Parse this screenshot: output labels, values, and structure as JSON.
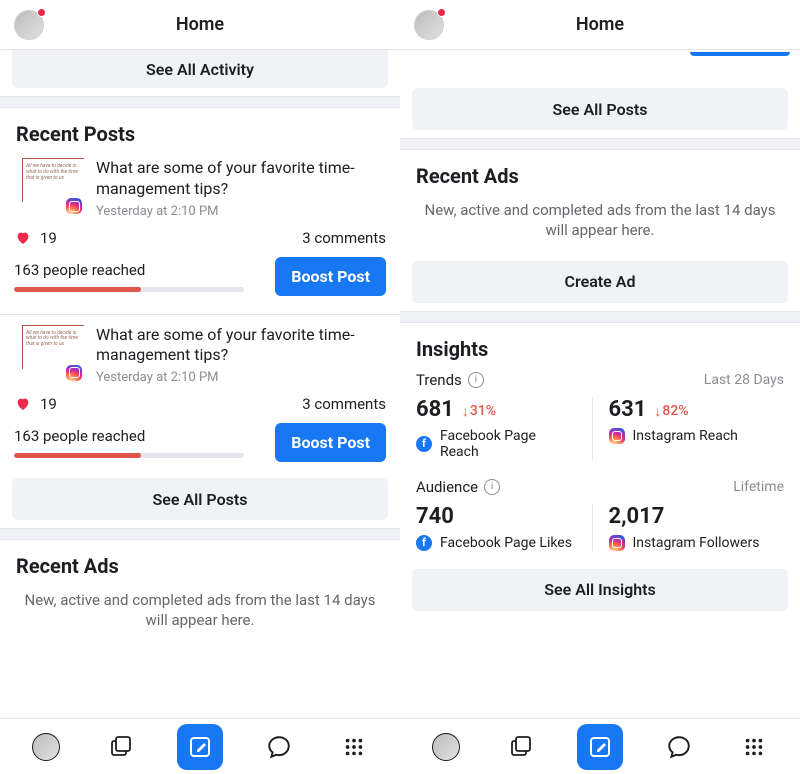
{
  "header": {
    "title": "Home"
  },
  "see_all_activity": "See All Activity",
  "recent_posts_title": "Recent Posts",
  "posts": [
    {
      "title": "What are some of your favorite time-management tips?",
      "timestamp": "Yesterday at 2:10 PM",
      "likes": "19",
      "comments": "3 comments",
      "reach": "163 people reached",
      "boost_label": "Boost Post",
      "reach_pct": 55,
      "thumb_text": "All we have to decide is what to do with the time that is given to us"
    },
    {
      "title": "What are some of your favorite time-management tips?",
      "timestamp": "Yesterday at 2:10 PM",
      "likes": "19",
      "comments": "3 comments",
      "reach": "163 people reached",
      "boost_label": "Boost Post",
      "reach_pct": 55,
      "thumb_text": "All we have to decide is what to do with the time that is given to us"
    }
  ],
  "see_all_posts": "See All Posts",
  "recent_ads": {
    "title": "Recent Ads",
    "empty_text": "New, active and completed ads from the last 14 days will appear here.",
    "create_label": "Create Ad"
  },
  "insights": {
    "title": "Insights",
    "trends_label": "Trends",
    "trends_range": "Last 28 Days",
    "audience_label": "Audience",
    "audience_range": "Lifetime",
    "metrics_trends": [
      {
        "value": "681",
        "delta": "31%",
        "label": "Facebook Page Reach",
        "network": "fb"
      },
      {
        "value": "631",
        "delta": "82%",
        "label": "Instagram Reach",
        "network": "ig"
      }
    ],
    "metrics_audience": [
      {
        "value": "740",
        "label": "Facebook Page Likes",
        "network": "fb"
      },
      {
        "value": "2,017",
        "label": "Instagram Followers",
        "network": "ig"
      }
    ],
    "see_all": "See All Insights"
  }
}
